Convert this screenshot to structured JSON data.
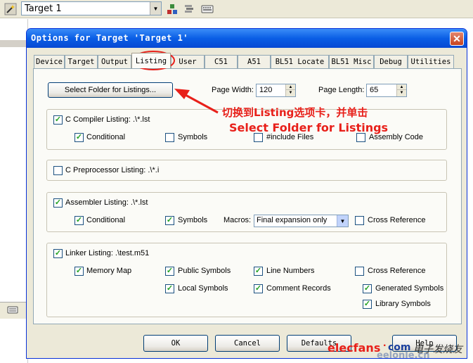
{
  "ide": {
    "target_select": "Target 1",
    "toolbar_left_icon": "wand-icon",
    "toolbar_icons": [
      "components-icon",
      "books-icon",
      "keyboard-icon"
    ]
  },
  "dialog": {
    "title": "Options for Target 'Target 1'",
    "close_glyph": "✕",
    "tabs": [
      "Device",
      "Target",
      "Output",
      "Listing",
      "User",
      "C51",
      "A51",
      "BL51 Locate",
      "BL51 Misc",
      "Debug",
      "Utilities"
    ],
    "active_tab": "Listing"
  },
  "listing": {
    "select_folder_button": "Select Folder for Listings...",
    "page_width_label": "Page Width:",
    "page_width_value": "120",
    "page_length_label": "Page Length:",
    "page_length_value": "65",
    "c_compiler": {
      "label": "C Compiler Listing:  .\\*.lst",
      "checked": true,
      "conditional": "Conditional",
      "symbols": "Symbols",
      "include_files": "#include Files",
      "assembly_code": "Assembly Code"
    },
    "c_preprocessor": {
      "label": "C Preprocessor Listing:  .\\*.i",
      "checked": false
    },
    "assembler": {
      "label": "Assembler Listing:  .\\*.lst",
      "checked": true,
      "conditional": "Conditional",
      "symbols": "Symbols",
      "macros_label": "Macros:",
      "macros_value": "Final expansion only",
      "cross_reference": "Cross Reference"
    },
    "linker": {
      "label": "Linker Listing:  .\\test.m51",
      "checked": true,
      "memory_map": "Memory Map",
      "public_symbols": "Public Symbols",
      "line_numbers": "Line Numbers",
      "cross_reference": "Cross Reference",
      "local_symbols": "Local Symbols",
      "comment_records": "Comment Records",
      "generated_symbols": "Generated Symbols",
      "library_symbols": "Library Symbols"
    }
  },
  "buttons": {
    "ok": "OK",
    "cancel": "Cancel",
    "defaults": "Defaults",
    "help": "Help"
  },
  "annotation": {
    "line1": "切换到Listing选项卡，并单击",
    "line2": "Select  Folder for Listings",
    "color": "#e8201a"
  },
  "watermark": {
    "brand": "elecfans",
    "dot": "·",
    "com": "com",
    "cn_text": "电子发烧友",
    "sub": "eelonle.cn"
  }
}
